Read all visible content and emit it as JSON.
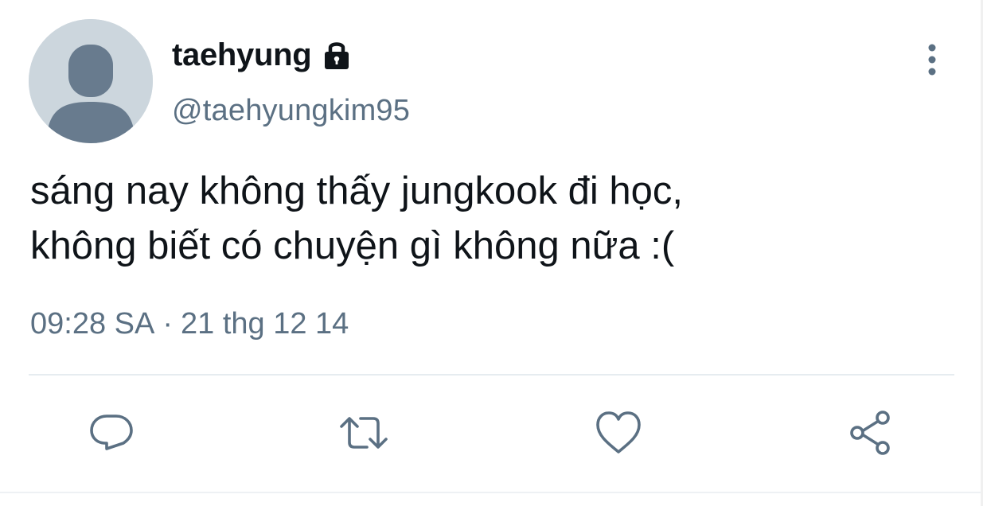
{
  "user": {
    "display_name": "taehyung",
    "handle": "@taehyungkim95",
    "protected_icon": "lock-icon",
    "avatar_icon": "default-avatar-icon"
  },
  "tweet": {
    "text_lines": [
      "sáng nay không thấy jungkook đi học,",
      "không biết có chuyện gì không nữa :("
    ],
    "time": "09:28 SA",
    "separator": "·",
    "date": "21 thg 12 14"
  },
  "actions": {
    "more": "more-vertical-icon",
    "reply": "reply-icon",
    "retweet": "retweet-icon",
    "like": "heart-icon",
    "share": "share-icon"
  },
  "colors": {
    "text_primary": "#0f1419",
    "text_secondary": "#5b7083",
    "avatar_bg": "#ccd6dd",
    "avatar_fg": "#687b8e",
    "icon": "#5b7083",
    "divider": "#e6ecf0"
  }
}
